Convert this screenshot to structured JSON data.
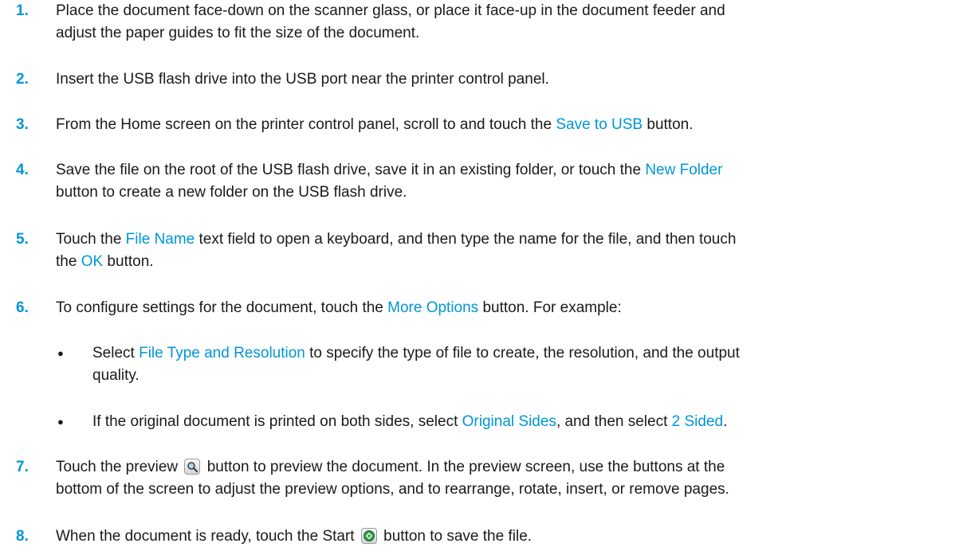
{
  "steps": [
    {
      "number": "1.",
      "line1": "Place the document face-down on the scanner glass, or place it face-up in the document feeder and",
      "line2": "adjust the paper guides to fit the size of the document."
    },
    {
      "number": "2.",
      "line1": "Insert the USB flash drive into the USB port near the printer control panel."
    },
    {
      "number": "3.",
      "before": "From the Home screen on the printer control panel, scroll to and touch the ",
      "ui": "Save to USB",
      "after": " button."
    },
    {
      "number": "4.",
      "before": "Save the file on the root of the USB flash drive, save it in an existing folder, or touch the ",
      "ui": "New Folder",
      "line2": "button to create a new folder on the USB flash drive."
    },
    {
      "number": "5.",
      "before": "Touch the ",
      "ui": "File Name",
      "after": " text field to open a keyboard, and then type the name for the file, and then touch",
      "line2_before": "the ",
      "ui2": "OK",
      "line2_after": " button."
    },
    {
      "number": "6.",
      "before": "To configure settings for the document, touch the ",
      "ui": "More Options",
      "after": " button. For example:",
      "bullets": [
        {
          "before": "Select ",
          "ui": "File Type and Resolution",
          "after": " to specify the type of file to create, the resolution, and the output",
          "line2": "quality."
        },
        {
          "before": "If the original document is printed on both sides, select ",
          "ui": "Original Sides",
          "middle": ", and then select ",
          "ui2": "2 Sided",
          "after": "."
        }
      ]
    },
    {
      "number": "7.",
      "before": "Touch the preview ",
      "after": " button to preview the document. In the preview screen, use the buttons at the",
      "line2": "bottom of the screen to adjust the preview options, and to rearrange, rotate, insert, or remove pages.",
      "icon": "magnifier-icon"
    },
    {
      "number": "8.",
      "before": "When the document is ready, touch the Start ",
      "after": " button to save the file.",
      "icon": "start-icon"
    }
  ],
  "colors": {
    "accent": "#0096d6",
    "text": "#1a1a1a",
    "start_green": "#2f9e44"
  }
}
